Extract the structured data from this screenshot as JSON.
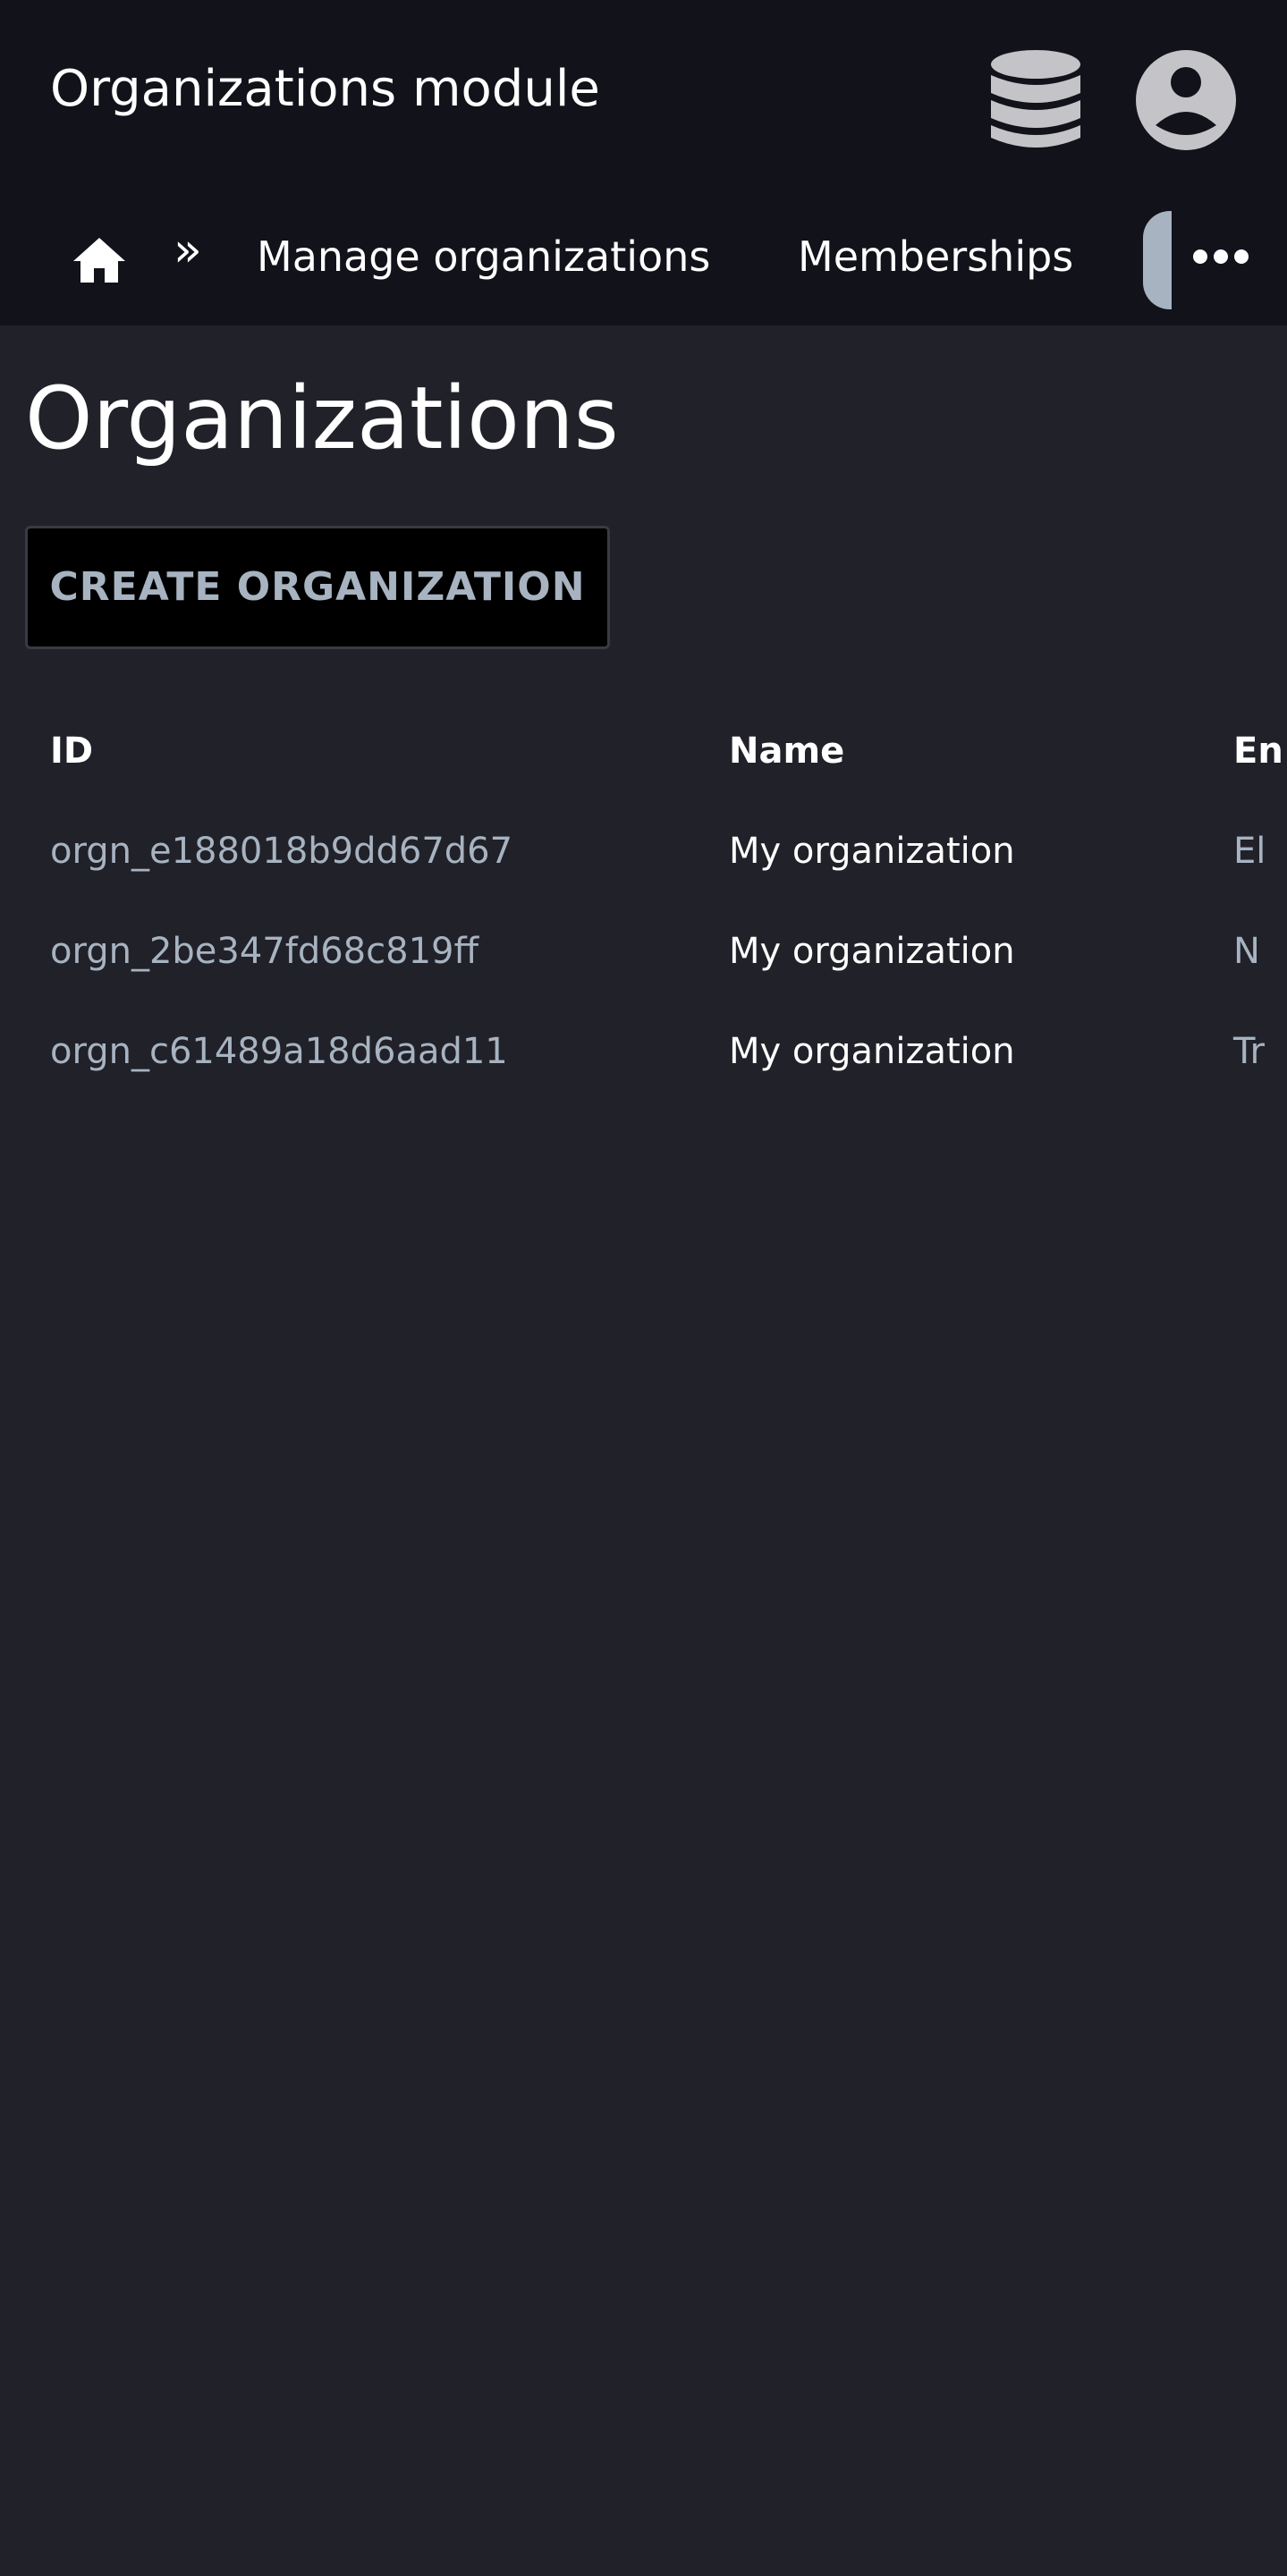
{
  "header": {
    "title": "Organizations module",
    "database_icon": "database-icon",
    "account_icon": "account-circle-icon"
  },
  "nav": {
    "home_icon": "home-icon",
    "separator": "»",
    "links": [
      {
        "label": "Manage organizations"
      },
      {
        "label": "Memberships"
      }
    ],
    "more_icon": "more-horizontal-icon"
  },
  "page": {
    "title": "Organizations",
    "create_button": "CREATE ORGANIZATION"
  },
  "table": {
    "columns": [
      "ID",
      "Name",
      "En"
    ],
    "rows": [
      {
        "id": "orgn_e188018b9dd67d67",
        "name": "My organization",
        "env": "El"
      },
      {
        "id": "orgn_2be347fd68c819ff",
        "name": "My organization",
        "env": "N"
      },
      {
        "id": "orgn_c61489a18d6aad11",
        "name": "My organization",
        "env": "Tr"
      }
    ]
  },
  "colors": {
    "background": "#21212a",
    "header_bg": "#12121b",
    "muted_text": "#a7b3c0",
    "icon_grey": "#c4c4c8",
    "button_bg": "#000000"
  }
}
